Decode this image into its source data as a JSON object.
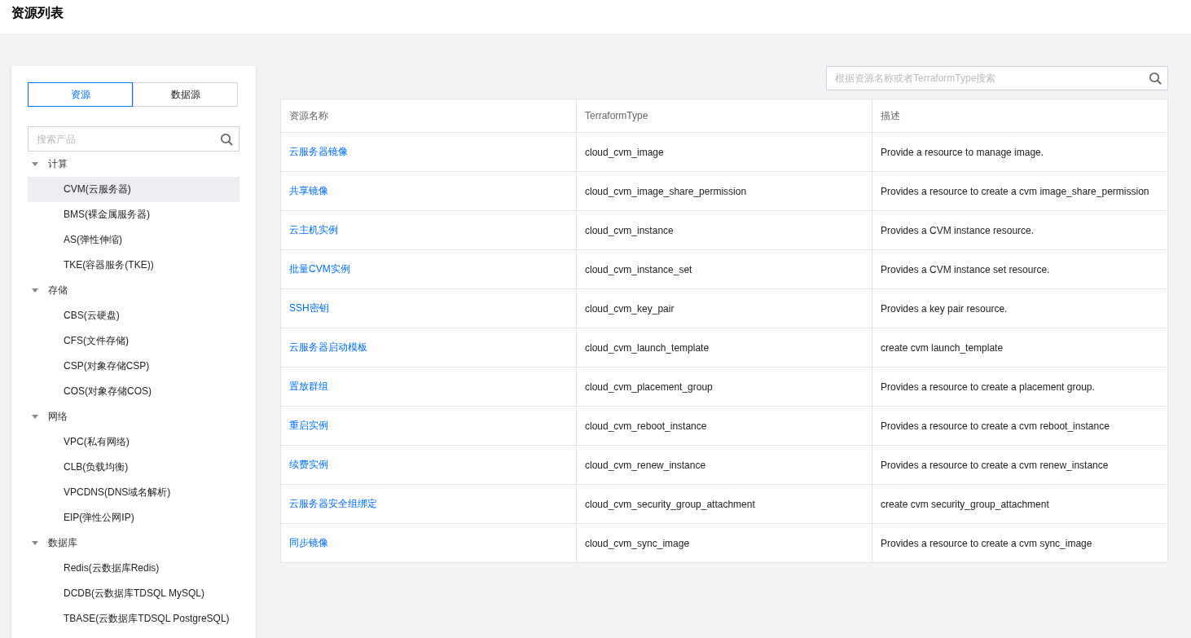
{
  "page_title": "资源列表",
  "sidebar": {
    "tabs": [
      {
        "label": "资源",
        "selected": true
      },
      {
        "label": "数据源",
        "selected": false
      }
    ],
    "search": {
      "placeholder": "搜索产品"
    },
    "tree": [
      {
        "label": "计算",
        "expanded": true,
        "children": [
          {
            "label": "CVM(云服务器)",
            "selected": true
          },
          {
            "label": "BMS(裸金属服务器)",
            "selected": false
          },
          {
            "label": "AS(弹性伸缩)",
            "selected": false
          },
          {
            "label": "TKE(容器服务(TKE))",
            "selected": false
          }
        ]
      },
      {
        "label": "存储",
        "expanded": true,
        "children": [
          {
            "label": "CBS(云硬盘)",
            "selected": false
          },
          {
            "label": "CFS(文件存储)",
            "selected": false
          },
          {
            "label": "CSP(对象存储CSP)",
            "selected": false
          },
          {
            "label": "COS(对象存储COS)",
            "selected": false
          }
        ]
      },
      {
        "label": "网络",
        "expanded": true,
        "children": [
          {
            "label": "VPC(私有网络)",
            "selected": false
          },
          {
            "label": "CLB(负载均衡)",
            "selected": false
          },
          {
            "label": "VPCDNS(DNS域名解析)",
            "selected": false
          },
          {
            "label": "EIP(弹性公网IP)",
            "selected": false
          }
        ]
      },
      {
        "label": "数据库",
        "expanded": true,
        "children": [
          {
            "label": "Redis(云数据库Redis)",
            "selected": false
          },
          {
            "label": "DCDB(云数据库TDSQL MySQL)",
            "selected": false
          },
          {
            "label": "TBASE(云数据库TDSQL PostgreSQL)",
            "selected": false
          }
        ]
      }
    ]
  },
  "search": {
    "placeholder": "根据资源名称或者TerraformType搜索"
  },
  "table": {
    "columns": [
      "资源名称",
      "TerraformType",
      "描述"
    ],
    "rows": [
      [
        "云服务器镜像",
        "cloud_cvm_image",
        "Provide a resource to manage image."
      ],
      [
        "共享镜像",
        "cloud_cvm_image_share_permission",
        "Provides a resource to create a cvm image_share_permission"
      ],
      [
        "云主机实例",
        "cloud_cvm_instance",
        "Provides a CVM instance resource."
      ],
      [
        "批量CVM实例",
        "cloud_cvm_instance_set",
        "Provides a CVM instance set resource."
      ],
      [
        "SSH密钥",
        "cloud_cvm_key_pair",
        "Provides a key pair resource."
      ],
      [
        "云服务器启动模板",
        "cloud_cvm_launch_template",
        "create cvm launch_template"
      ],
      [
        "置放群组",
        "cloud_cvm_placement_group",
        "Provides a resource to create a placement group."
      ],
      [
        "重启实例",
        "cloud_cvm_reboot_instance",
        "Provides a resource to create a cvm reboot_instance"
      ],
      [
        "续费实例",
        "cloud_cvm_renew_instance",
        "Provides a resource to create a cvm renew_instance"
      ],
      [
        "云服务器安全组绑定",
        "cloud_cvm_security_group_attachment",
        "create cvm security_group_attachment"
      ],
      [
        "同步镜像",
        "cloud_cvm_sync_image",
        "Provides a resource to create a cvm sync_image"
      ]
    ]
  }
}
